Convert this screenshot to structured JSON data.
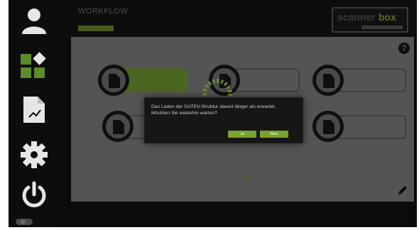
{
  "header": {
    "title": "WORKFLOW",
    "subtitle": ""
  },
  "logo": {
    "part1": "scanner",
    "part2": "box",
    "tagline": ""
  },
  "sidebar": {
    "items": [
      {
        "name": "user",
        "icon": "user-icon"
      },
      {
        "name": "workflow",
        "icon": "grid-diamond-icon"
      },
      {
        "name": "document",
        "icon": "document-chart-icon"
      },
      {
        "name": "settings",
        "icon": "gear-icon"
      },
      {
        "name": "power",
        "icon": "power-icon"
      }
    ]
  },
  "tiles": [
    {
      "label": "",
      "active": true
    },
    {
      "label": "",
      "active": false
    },
    {
      "label": "",
      "active": false
    },
    {
      "label": "",
      "active": false
    },
    {
      "label": "",
      "active": false
    },
    {
      "label": "",
      "active": false
    }
  ],
  "dialog": {
    "message_line1": "Das Laden der DATEV-Struktur dauert länger als erwartet.",
    "message_line2": "Möchten Sie weiterhin warten?",
    "yes_label": "Ja",
    "no_label": "Nein"
  },
  "colors": {
    "accent": "#78a32c",
    "active_tile": "#4b6620",
    "content_bg": "#545454",
    "background": "#0b0b0b"
  }
}
